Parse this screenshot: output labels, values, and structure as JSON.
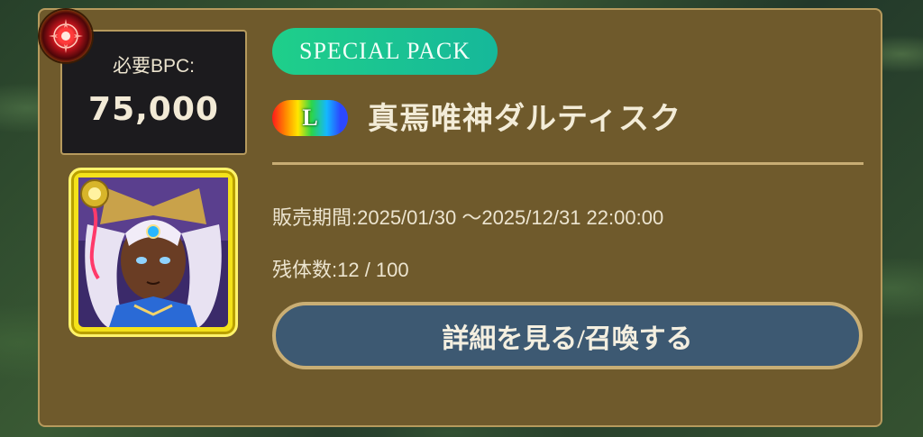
{
  "pack": {
    "badge_label": "SPECIAL PACK",
    "cost_label": "必要BPC:",
    "cost_value": "75,000",
    "rarity": "L",
    "character_name": "真焉唯神ダルティスク",
    "sale_period": "販売期間:2025/01/30 ～2025/12/31 22:00:00",
    "remaining": "残体数:12 / 100",
    "action_label": "詳細を見る/召喚する"
  },
  "icons": {
    "emblem": "red-eye-emblem-icon",
    "portrait": "character-portrait-icon",
    "element": "light-element-orb-icon"
  },
  "colors": {
    "card": "#6f5a2c",
    "card_border": "#b69a5d",
    "badge": "#1fcf8a",
    "button": "#3d5972"
  }
}
